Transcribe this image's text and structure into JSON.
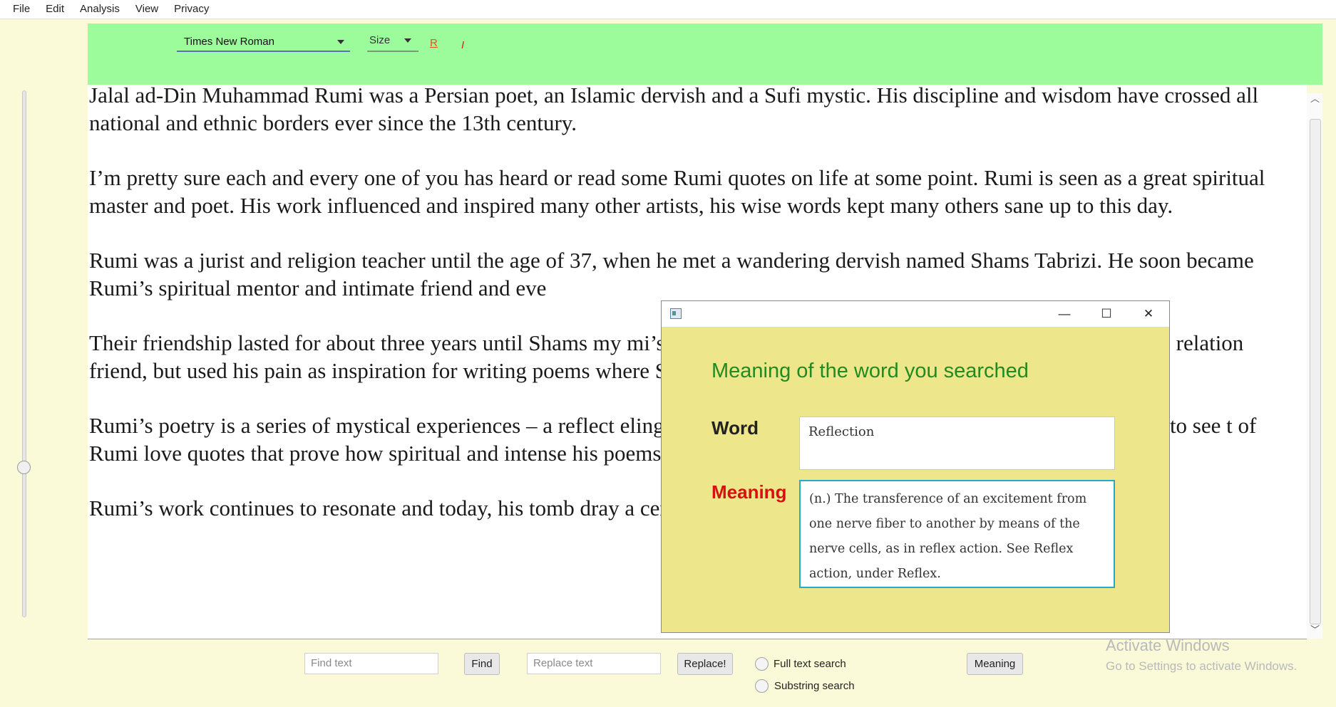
{
  "menu": [
    "File",
    "Edit",
    "Analysis",
    "View",
    "Privacy"
  ],
  "toolbar": {
    "font_family": "Times New Roman",
    "size_label": "Size",
    "r_label": "R",
    "italic_label": "I"
  },
  "document": {
    "paragraphs": [
      "Jalal ad-Din Muhammad Rumi was a Persian poet, an Islamic dervish and a Sufi mystic. His discipline and wisdom have crossed all national and ethnic borders ever since the 13th century.",
      "I’m pretty sure each and every one of you has heard or read some Rumi quotes on life at some point. Rumi is seen as a great spiritual master and poet. His work influenced and inspired many other artists, his wise words kept many others sane up to this day.",
      "Rumi was a jurist and religion teacher until the age of 37, when he met a wandering dervish named Shams Tabrizi. He soon became Rumi’s spiritual mentor and intimate friend and eve",
      "Their friendship lasted for about three years until Shams my                                                    mi’s sons murdered him because he was jealous of their close relation                                                       friend, but used his pain as inspiration for writing poems where Shams",
      "Rumi’s poetry is a series of mystical experiences – a reflect                                                         eling… anything that makes us human, everything we’re able to see                                                        t of Rumi love quotes that prove how spiritual and intense his poems a",
      "Rumi’s work continues to resonate and today, his tomb dray                                                       a ceremony that marks the anniversary of his death."
    ]
  },
  "bottom": {
    "find_placeholder": "Find text",
    "find_button": "Find",
    "replace_placeholder": "Replace text",
    "replace_button": "Replace!",
    "full_text_label": "Full text search",
    "substring_label": "Substring search",
    "meaning_button": "Meaning",
    "watermark_title": "Activate Windows",
    "watermark_sub": "Go to Settings to activate Windows."
  },
  "dialog": {
    "heading": "Meaning of the word you searched",
    "word_label": "Word",
    "word_value": "Reflection",
    "meaning_label": "Meaning",
    "meaning_value": "(n.) The transference of an excitement from one nerve fiber to another by means of the nerve cells, as in reflex action. See Reflex action, under Reflex.",
    "minimize": "—",
    "maximize": "☐",
    "close": "✕"
  },
  "colors": {
    "toolbar_bg": "#9cfc9c",
    "dialog_bg": "#ede68a",
    "heading_green": "#218a21",
    "meaning_red": "#d81010",
    "app_bg": "#fafad8"
  }
}
